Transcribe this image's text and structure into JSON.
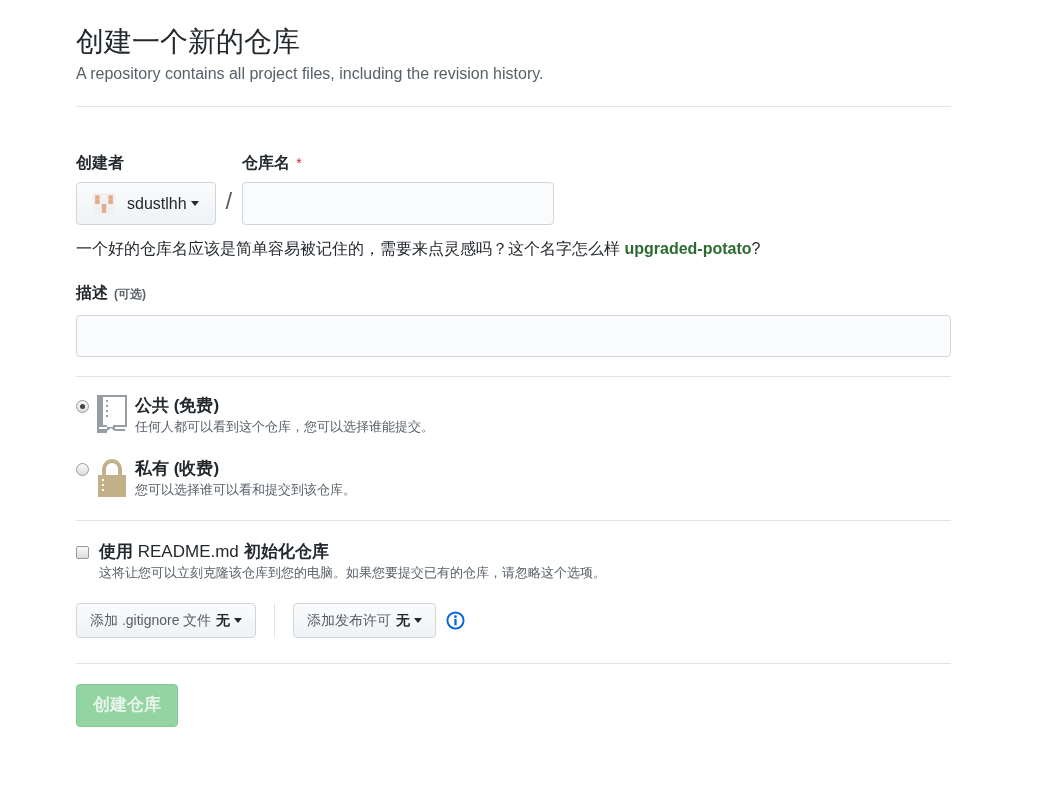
{
  "header": {
    "title": "创建一个新的仓库",
    "subtitle": "A repository contains all project files, including the revision history."
  },
  "owner": {
    "label": "创建者",
    "value": "sdustlhh"
  },
  "separator": "/",
  "repo_name": {
    "label": "仓库名",
    "required_mark": "*"
  },
  "suggestion": {
    "text": "一个好的仓库名应该是简单容易被记住的，需要来点灵感吗？这个名字怎么样 ",
    "link": "upgraded-potato",
    "after": "?"
  },
  "description": {
    "label": "描述",
    "optional": "(可选)"
  },
  "visibility": [
    {
      "kind": "public",
      "title": "公共 (免费)",
      "detail": "任何人都可以看到这个仓库，您可以选择谁能提交。",
      "selected": true
    },
    {
      "kind": "private",
      "title": "私有 (收费)",
      "detail": "您可以选择谁可以看和提交到该仓库。",
      "selected": false
    }
  ],
  "init_readme": {
    "title_prefix": "使用 ",
    "title_code": "README.md",
    "title_suffix": " 初始化仓库",
    "detail": "这将让您可以立刻克隆该仓库到您的电脑。如果您要提交已有的仓库，请忽略这个选项。",
    "checked": false
  },
  "dropdowns": [
    {
      "label": "添加 .gitignore 文件",
      "value": "无"
    },
    {
      "label": "添加发布许可",
      "value": "无"
    }
  ],
  "submit": {
    "label": "创建仓库",
    "disabled": true
  }
}
